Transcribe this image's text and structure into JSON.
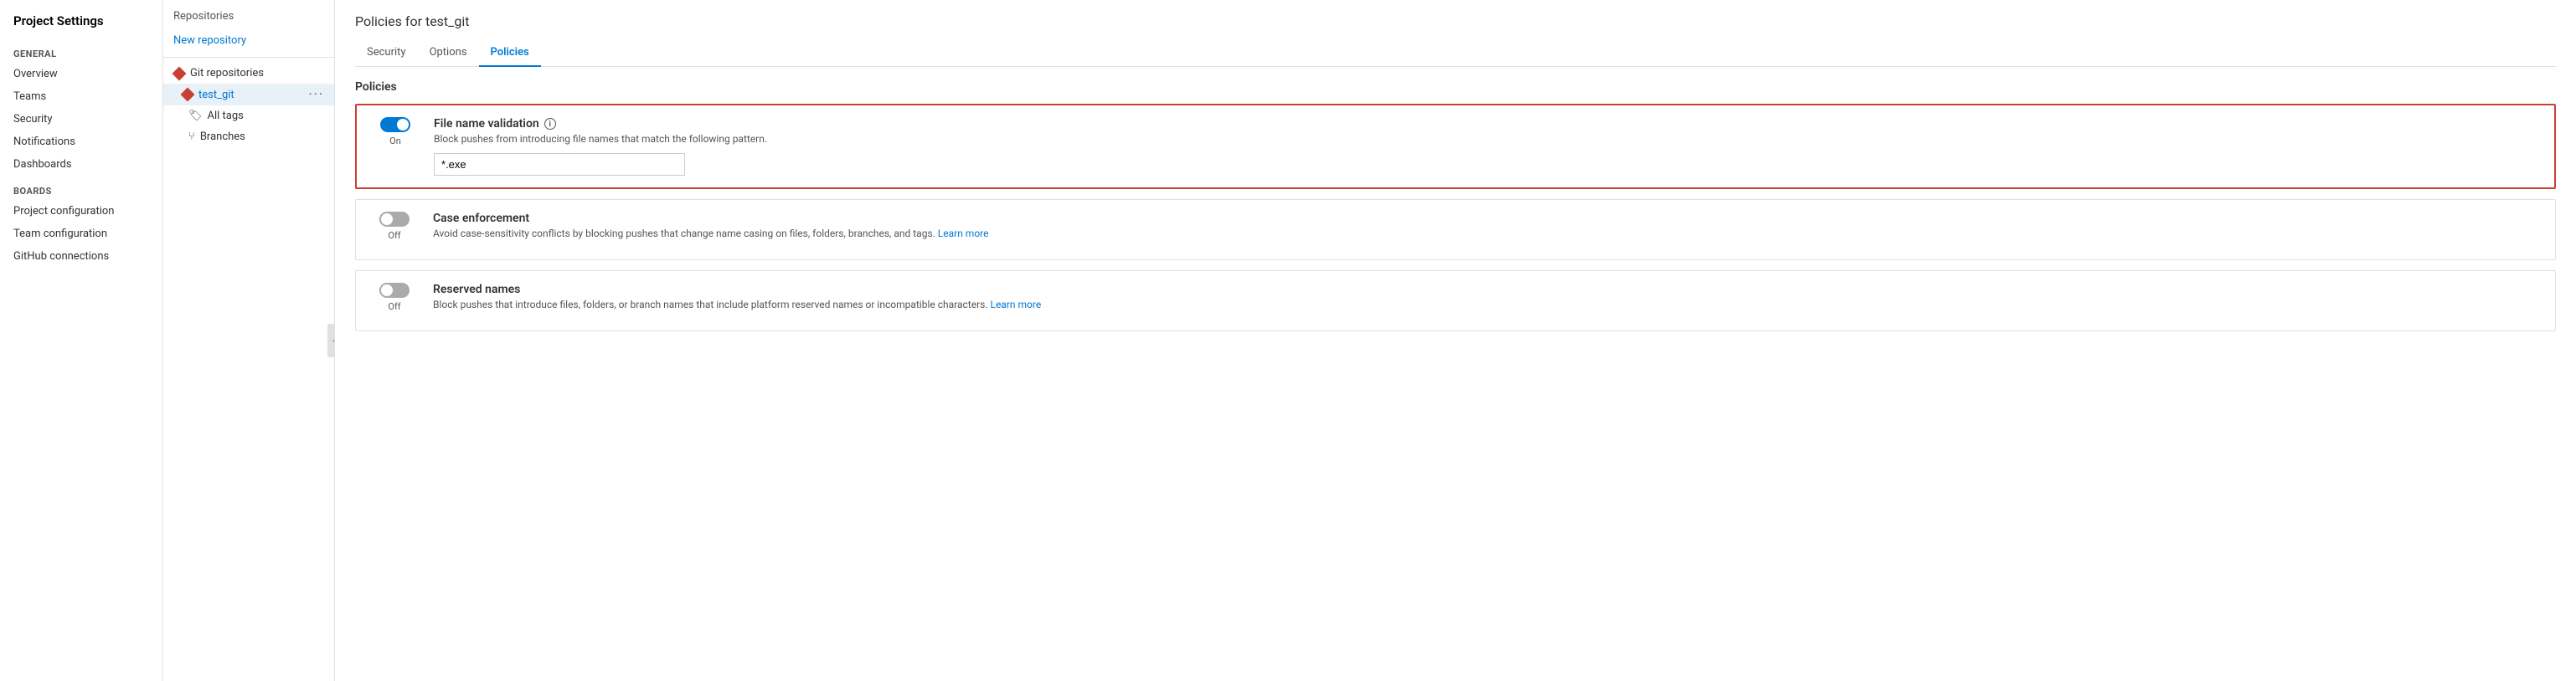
{
  "leftSidebar": {
    "title": "Project Settings",
    "generalSection": {
      "label": "General",
      "items": [
        {
          "id": "overview",
          "label": "Overview"
        },
        {
          "id": "teams",
          "label": "Teams"
        },
        {
          "id": "security",
          "label": "Security"
        },
        {
          "id": "notifications",
          "label": "Notifications"
        },
        {
          "id": "dashboards",
          "label": "Dashboards"
        }
      ]
    },
    "boardsSection": {
      "label": "Boards",
      "items": [
        {
          "id": "project-configuration",
          "label": "Project configuration"
        },
        {
          "id": "team-configuration",
          "label": "Team configuration"
        },
        {
          "id": "github-connections",
          "label": "GitHub connections"
        }
      ]
    }
  },
  "middlePanel": {
    "title": "Repositories",
    "newRepositoryLabel": "New repository",
    "gitRepositoriesLabel": "Git repositories",
    "repoName": "test_git",
    "allTagsLabel": "All tags",
    "branchesLabel": "Branches",
    "moreLabel": "···"
  },
  "mainContent": {
    "pageTitle": "Policies for test_git",
    "tabs": [
      {
        "id": "security",
        "label": "Security",
        "active": false
      },
      {
        "id": "options",
        "label": "Options",
        "active": false
      },
      {
        "id": "policies",
        "label": "Policies",
        "active": true
      }
    ],
    "policiesSectionTitle": "Policies",
    "policies": [
      {
        "id": "file-name-validation",
        "name": "File name validation",
        "hasInfo": true,
        "description": "Block pushes from introducing file names that match the following pattern.",
        "toggleState": "on",
        "toggleLabel": "On",
        "highlighted": true,
        "inputValue": "*.exe",
        "inputPlaceholder": "*.exe"
      },
      {
        "id": "case-enforcement",
        "name": "Case enforcement",
        "hasInfo": false,
        "description": "Avoid case-sensitivity conflicts by blocking pushes that change name casing on files, folders, branches, and tags.",
        "toggleState": "off",
        "toggleLabel": "Off",
        "highlighted": false,
        "learnMoreLabel": "Learn more"
      },
      {
        "id": "reserved-names",
        "name": "Reserved names",
        "hasInfo": false,
        "description": "Block pushes that introduce files, folders, or branch names that include platform reserved names or incompatible characters.",
        "toggleState": "off",
        "toggleLabel": "Off",
        "highlighted": false,
        "learnMoreLabel": "Learn more"
      }
    ]
  }
}
